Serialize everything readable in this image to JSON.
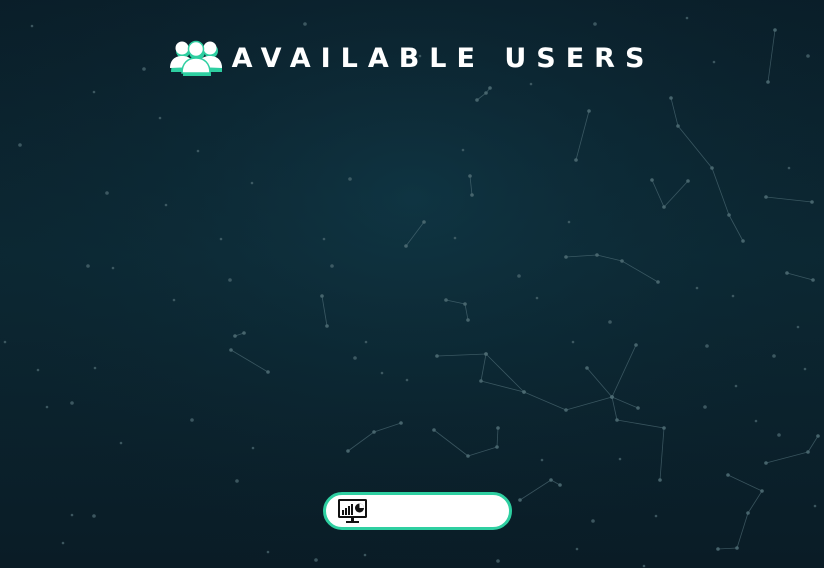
{
  "header": {
    "title": "AVAILABLE USERS",
    "icon": "users-group-icon"
  },
  "dashboard_button": {
    "icon": "monitor-analytics-icon",
    "label": ""
  },
  "colors": {
    "background_top": "#0a1e29",
    "background_mid": "#0c2833",
    "background_bottom": "#0a1c26",
    "accent": "#2ecfa1",
    "title_text": "#ffffff",
    "button_fill": "#ffffff",
    "network_line": "#5f7d86",
    "network_dot": "#4d6a72"
  }
}
